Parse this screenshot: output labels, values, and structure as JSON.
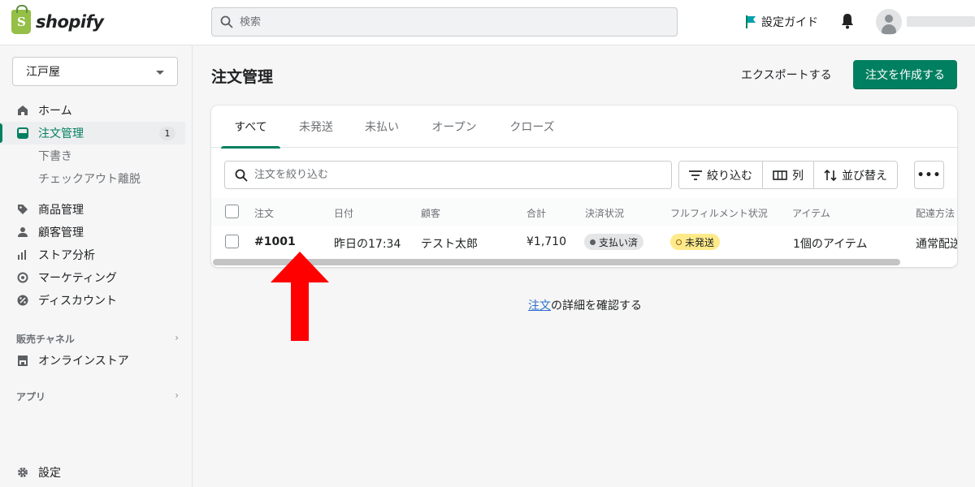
{
  "topbar": {
    "brand": "shopify",
    "search_placeholder": "検索",
    "setup_guide": "設定ガイド"
  },
  "sidebar": {
    "store_name": "江戸屋",
    "items": [
      {
        "label": "ホーム",
        "icon": "home-icon"
      },
      {
        "label": "注文管理",
        "icon": "orders-icon",
        "badge": "1",
        "active": true
      },
      {
        "label": "下書き"
      },
      {
        "label": "チェックアウト離脱"
      },
      {
        "label": "商品管理",
        "icon": "tag-icon"
      },
      {
        "label": "顧客管理",
        "icon": "person-icon"
      },
      {
        "label": "ストア分析",
        "icon": "bar-chart-icon"
      },
      {
        "label": "マーケティング",
        "icon": "target-icon"
      },
      {
        "label": "ディスカウント",
        "icon": "discount-icon"
      }
    ],
    "sales_channels_title": "販売チャネル",
    "online_store": "オンラインストア",
    "apps_title": "アプリ",
    "settings": "設定"
  },
  "main": {
    "title": "注文管理",
    "export_label": "エクスポートする",
    "create_label": "注文を作成する",
    "tabs": [
      "すべて",
      "未発送",
      "未払い",
      "オープン",
      "クローズ"
    ],
    "filter_placeholder": "注文を絞り込む",
    "filter_button": "絞り込む",
    "columns_button": "列",
    "sort_button": "並び替え",
    "more_button": "•••",
    "table": {
      "headers": [
        "注文",
        "日付",
        "顧客",
        "合計",
        "決済状況",
        "フルフィルメント状況",
        "アイテム",
        "配達方法"
      ],
      "rows": [
        {
          "order": "#1001",
          "date": "昨日の17:34",
          "customer": "テスト太郎",
          "total": "¥1,710",
          "payment": "支払い済",
          "fulfillment": "未発送",
          "items": "1個のアイテム",
          "delivery": "通常配送"
        }
      ]
    },
    "help_link": "注文",
    "help_text": "の詳細を確認する"
  },
  "colors": {
    "primary": "#008060",
    "annotation_arrow": "#ff0000",
    "unfulfilled_badge": "#ffea8a"
  }
}
